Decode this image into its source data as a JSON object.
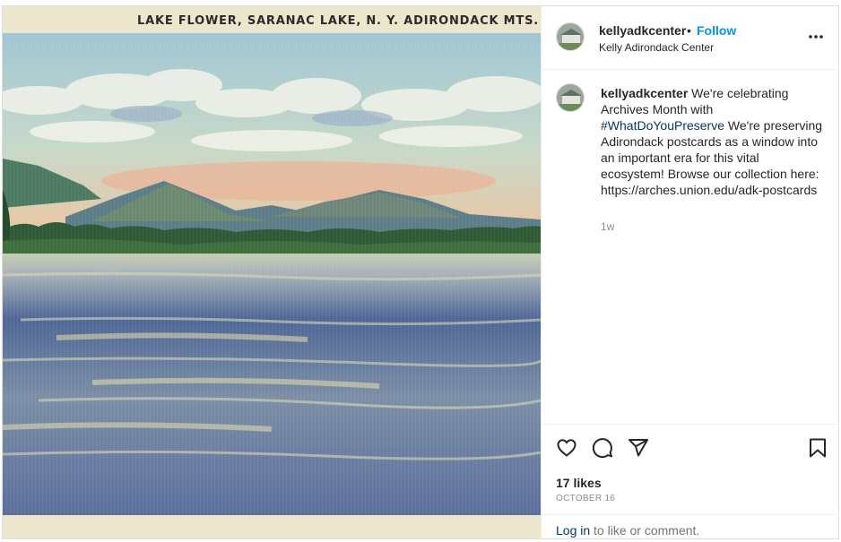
{
  "postcard": {
    "caption": "LAKE FLOWER, SARANAC LAKE, N. Y.   ADIRONDACK MTS."
  },
  "header": {
    "username": "kellyadkcenter",
    "separator": "•",
    "follow_label": "Follow",
    "location": "Kelly Adirondack Center",
    "more_icon": "more-horizontal-icon"
  },
  "comment": {
    "username": "kellyadkcenter",
    "text_before": " We're celebrating Archives Month with ",
    "hashtag": "#WhatDoYouPreserve",
    "text_after": " We're preserving Adirondack postcards as a window into an important era for this vital ecosystem! Browse our collection here: https://arches.union.edu/adk-postcards",
    "time": "1w"
  },
  "actions": {
    "icons": [
      "heart-icon",
      "comment-icon",
      "share-icon",
      "bookmark-icon"
    ],
    "likes": "17 likes",
    "date": "OCTOBER 16"
  },
  "login": {
    "link": "Log in",
    "text": " to like or comment."
  },
  "colors": {
    "link_blue": "#0095f6",
    "hashtag": "#00376b",
    "muted": "#8e8e8e",
    "border": "#dbdbdb"
  }
}
